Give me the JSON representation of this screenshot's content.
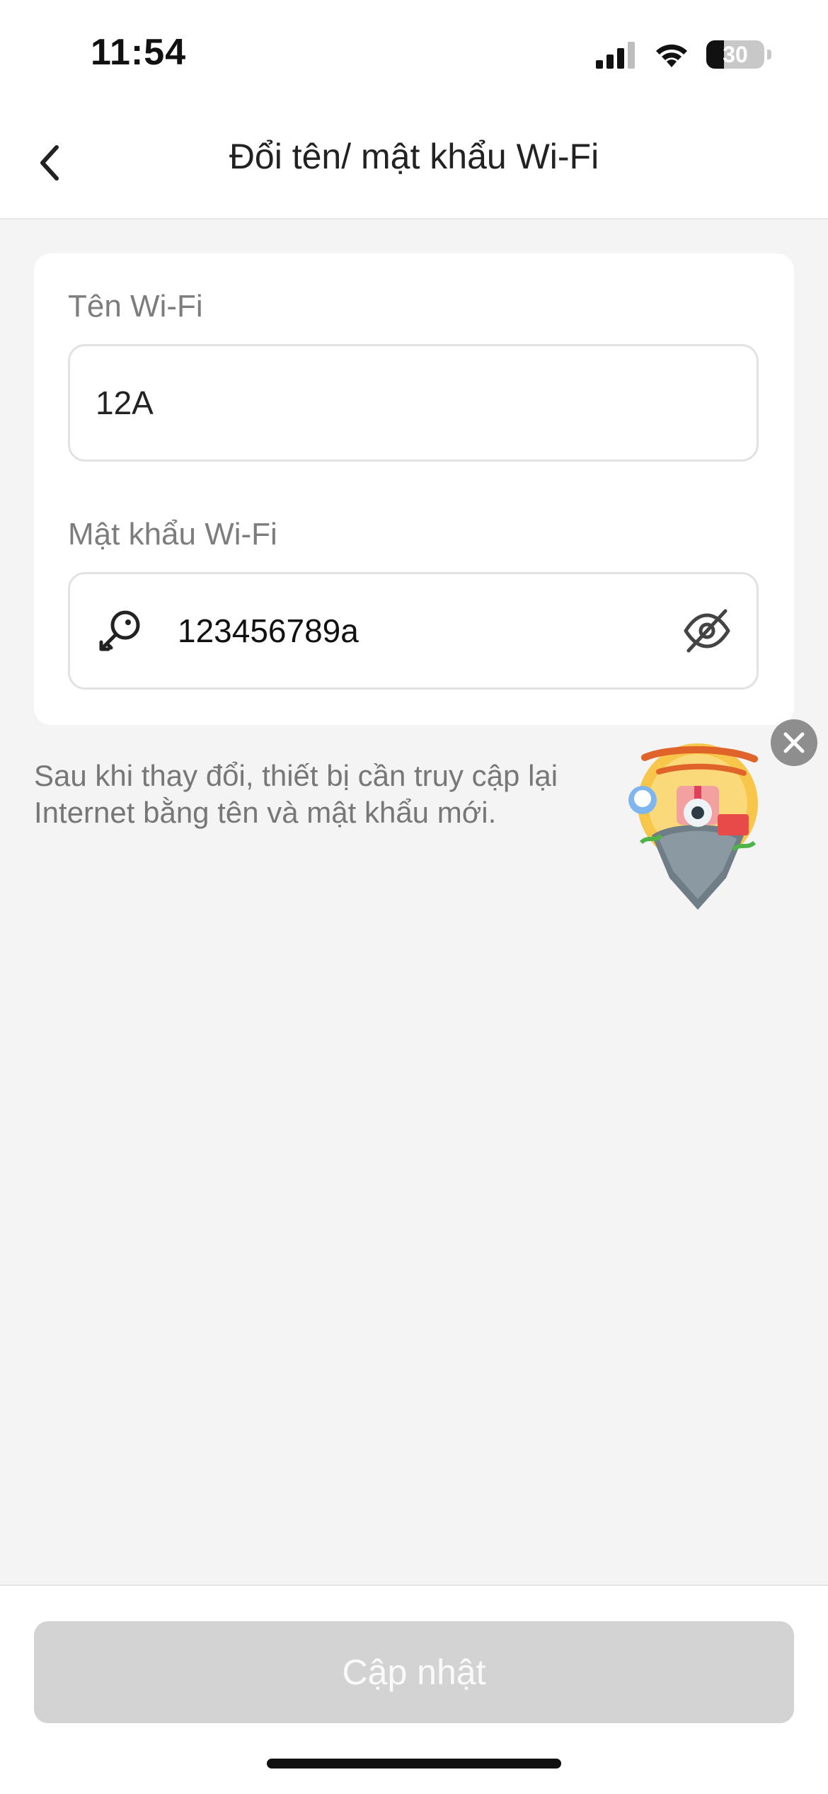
{
  "status_bar": {
    "time": "11:54",
    "battery": "30"
  },
  "nav": {
    "title": "Đổi tên/ mật khẩu Wi-Fi",
    "back_icon": "chevron-left-icon"
  },
  "form": {
    "wifi_name": {
      "label": "Tên Wi-Fi",
      "value": "12A"
    },
    "wifi_password": {
      "label": "Mật khẩu Wi-Fi",
      "value": "123456789a",
      "leading_icon": "key-icon",
      "trailing_icon": "eye-off-icon"
    }
  },
  "hint": "Sau khi thay đổi, thiết bị cần truy cập lại Internet bằng tên và mật khẩu mới.",
  "promo": {
    "close_icon": "close-icon"
  },
  "footer": {
    "update_label": "Cập nhật"
  },
  "colors": {
    "page_bg": "#f4f4f4",
    "card_bg": "#ffffff",
    "disabled_button": "#d3d3d3",
    "label_gray": "#7d7d7d"
  }
}
